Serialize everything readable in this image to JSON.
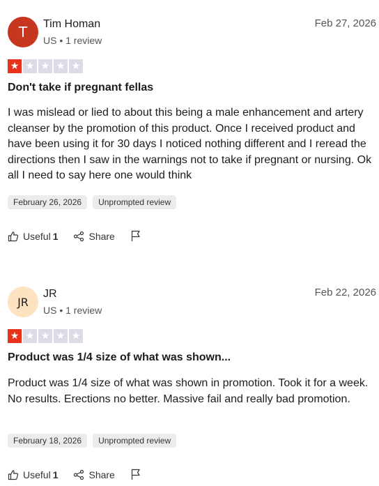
{
  "reviews": [
    {
      "avatar_text": "T",
      "avatar_bg": "#c7371f",
      "avatar_fg": "#ffffff",
      "name": "Tim Homan",
      "meta": "US • 1 review",
      "date": "Feb 27, 2026",
      "rating": 1,
      "title": "Don't take if pregnant fellas",
      "body": "I was mislead or lied to about this being a male enhancement and artery cleanser by the promotion of this product. Once I received product and have been using it for 30 days I noticed nothing different and I reread the directions then I saw in the warnings not to take if pregnant or nursing. Ok all I need to say here one would think",
      "experience_date": "February 26, 2026",
      "tag": "Unprompted review",
      "useful_label": "Useful",
      "useful_count": "1",
      "share_label": "Share"
    },
    {
      "avatar_text": "JR",
      "avatar_bg": "#fde3c0",
      "avatar_fg": "#1c1c1c",
      "name": "JR",
      "meta": "US • 1 review",
      "date": "Feb 22, 2026",
      "rating": 1,
      "title": "Product was 1/4 size of what was shown...",
      "body": "Product was 1/4 size of what was shown in promotion. Took it for a week. No results. Erections no better. Massive fail and really bad promotion.",
      "experience_date": "February 18, 2026",
      "tag": "Unprompted review",
      "useful_label": "Useful",
      "useful_count": "1",
      "share_label": "Share"
    }
  ],
  "colors": {
    "star_filled": "#e8331c",
    "star_empty": "#dcdce6"
  },
  "icons": [
    "thumbs-up-icon",
    "share-icon",
    "flag-icon",
    "star-icon"
  ]
}
